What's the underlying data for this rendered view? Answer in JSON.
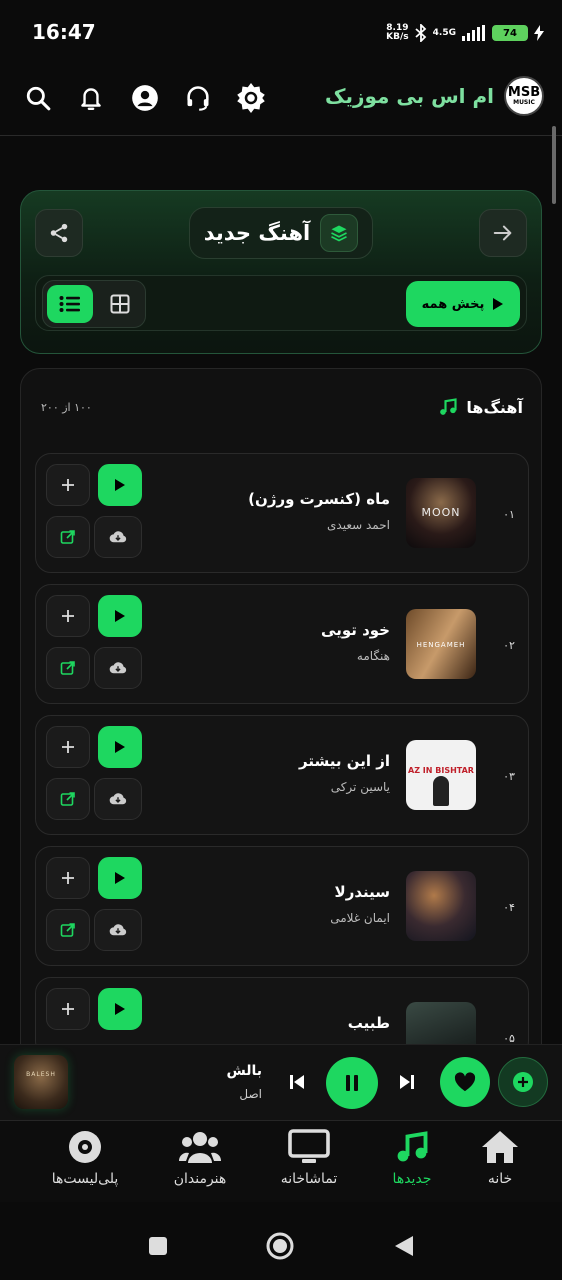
{
  "status_bar": {
    "time": "16:47",
    "net_speed_value": "8.19",
    "net_speed_unit": "KB/s",
    "network": "4.5G",
    "battery": "74"
  },
  "header": {
    "brand_title": "ام اس بی موزیک",
    "logo_text": "MSB",
    "logo_sub": "MUSIC"
  },
  "hero": {
    "title": "آهنگ جدید",
    "play_all_label": "پخش همه"
  },
  "songs_panel": {
    "title": "آهنگ‌ها",
    "count_text": "۱۰۰ از ۲۰۰"
  },
  "songs": [
    {
      "rank": "۰۱",
      "title": "ماه (کنسرت ورژن)",
      "artist": "احمد سعیدی",
      "cover_text": "MOON"
    },
    {
      "rank": "۰۲",
      "title": "خود تویی",
      "artist": "هنگامه",
      "cover_text": "HENGAMEH"
    },
    {
      "rank": "۰۳",
      "title": "از این بیشتر",
      "artist": "یاسین ترکی",
      "cover_text": "AZ IN BISHTAR"
    },
    {
      "rank": "۰۴",
      "title": "سیندرلا",
      "artist": "ایمان غلامی",
      "cover_text": ""
    },
    {
      "rank": "۰۵",
      "title": "طبیب",
      "artist": "",
      "cover_text": ""
    }
  ],
  "mini_player": {
    "title": "بالش",
    "subtitle": "اصل",
    "cover_text": "BALESH"
  },
  "bottom_nav": {
    "items": [
      {
        "label": "خانه",
        "icon": "home-icon"
      },
      {
        "label": "جدیدها",
        "icon": "music-note-icon",
        "active": true
      },
      {
        "label": "تماشاخانه",
        "icon": "tv-icon"
      },
      {
        "label": "هنرمندان",
        "icon": "users-icon"
      },
      {
        "label": "پلی‌لیست‌ها",
        "icon": "disc-icon"
      }
    ]
  },
  "colors": {
    "accent": "#1ed760",
    "background": "#0b0b0b"
  }
}
